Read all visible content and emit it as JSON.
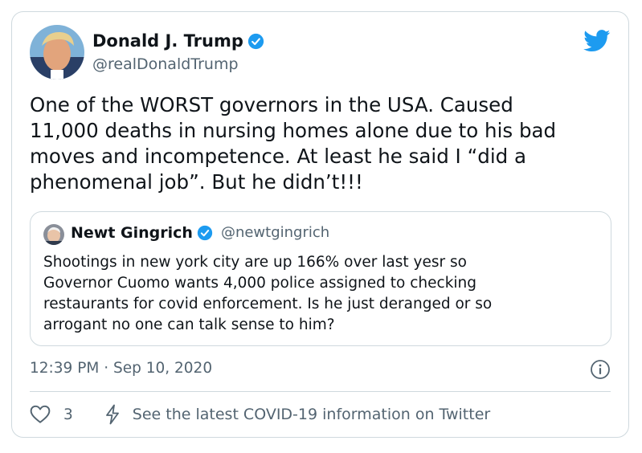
{
  "tweet": {
    "author": {
      "display_name": "Donald J. Trump",
      "handle": "@realDonaldTrump",
      "verified": true,
      "avatar_icon": "profile-photo"
    },
    "text": "One of the WORST governors in the USA. Caused\n11,000 deaths in nursing homes alone due to his bad\nmoves and incompetence. At least he said I “did a\nphenomenal job”. But he didn’t!!!",
    "quoted_tweet": {
      "author": {
        "display_name": "Newt Gingrich",
        "handle": "@newtgingrich",
        "verified": true,
        "avatar_icon": "profile-photo"
      },
      "text": "Shootings in new york city are up 166% over last yesr so\nGovernor Cuomo wants 4,000 police assigned to checking\nrestaurants for covid enforcement. Is he just deranged or so\narrogant no one can talk sense to him?"
    },
    "timestamp": "12:39 PM · Sep 10, 2020",
    "like_count": "3",
    "covid_notice": "See the latest COVID-19 information on Twitter"
  },
  "icons": {
    "brand": "twitter-bird-icon",
    "verified": "verified-badge-icon",
    "info": "info-icon",
    "like": "heart-icon",
    "covid": "lightning-bolt-icon"
  },
  "colors": {
    "twitter_blue": "#1d9bf0",
    "text_primary": "#0f1419",
    "text_secondary": "#536471",
    "border": "#cfd9de"
  }
}
